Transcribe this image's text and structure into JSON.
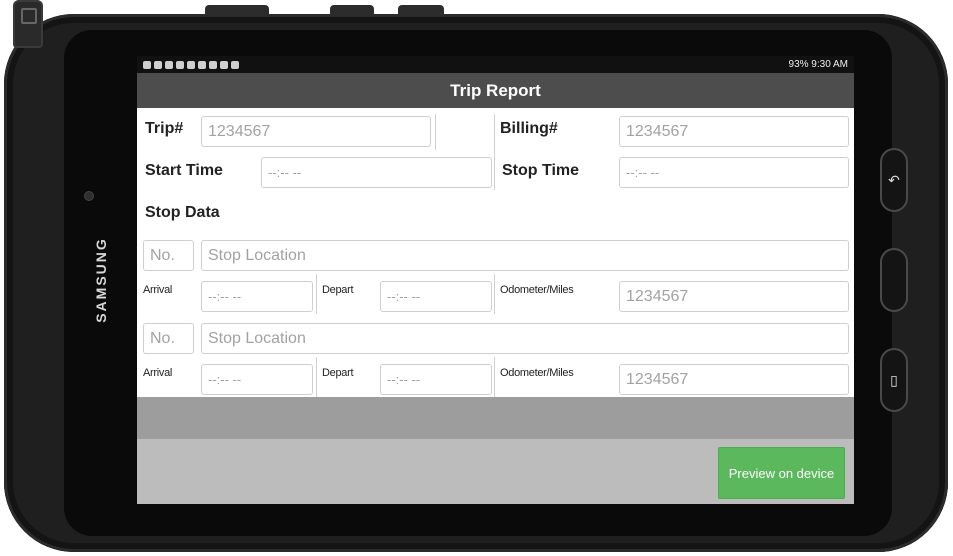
{
  "device": {
    "brand": "SAMSUNG",
    "back_icon": "back-icon",
    "home_icon": "home-button",
    "recents_icon": "recents-icon"
  },
  "statusbar": {
    "right_text": "93% 9:30 AM"
  },
  "title": "Trip Report",
  "form": {
    "trip_label": "Trip#",
    "trip_placeholder": "1234567",
    "billing_label": "Billing#",
    "billing_placeholder": "1234567",
    "start_label": "Start Time",
    "start_placeholder": "--:-- --",
    "stop_label": "Stop Time",
    "stop_placeholder": "--:-- --",
    "stop_data_label": "Stop Data",
    "stops": [
      {
        "no_placeholder": "No.",
        "location_placeholder": "Stop Location",
        "arrival_label": "Arrival",
        "arrival_placeholder": "--:-- --",
        "depart_label": "Depart",
        "depart_placeholder": "--:-- --",
        "odometer_label": "Odometer/Miles",
        "odometer_placeholder": "1234567"
      },
      {
        "no_placeholder": "No.",
        "location_placeholder": "Stop Location",
        "arrival_label": "Arrival",
        "arrival_placeholder": "--:-- --",
        "depart_label": "Depart",
        "depart_placeholder": "--:-- --",
        "odometer_label": "Odometer/Miles",
        "odometer_placeholder": "1234567"
      }
    ]
  },
  "footer": {
    "preview_label": "Preview on device",
    "preview_color": "#5cb85c"
  }
}
